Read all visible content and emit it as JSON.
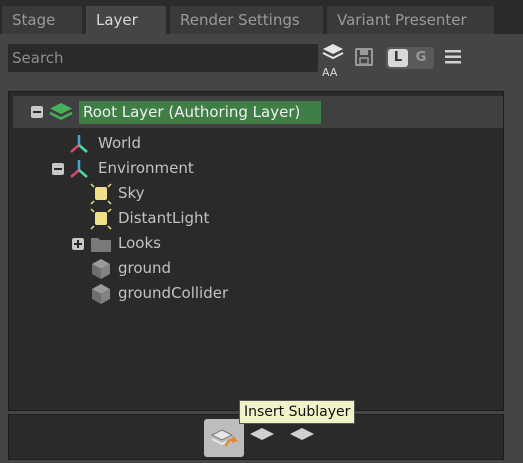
{
  "tabs": [
    {
      "label": "Stage",
      "active": false
    },
    {
      "label": "Layer",
      "active": true
    },
    {
      "label": "Render Settings",
      "active": false
    },
    {
      "label": "Variant Presenter",
      "active": false
    }
  ],
  "toolbar": {
    "search_placeholder": "Search",
    "stack_caption": "AA",
    "toggle_l": "L",
    "toggle_g": "G"
  },
  "tree": {
    "root": {
      "label": "Root Layer (Authoring Layer)",
      "expanded": true,
      "icon": "layers-stack-icon"
    },
    "items": [
      {
        "label": "World",
        "icon": "xform-axis-icon",
        "expander": "none"
      },
      {
        "label": "Environment",
        "icon": "xform-axis-icon",
        "expander": "expanded"
      },
      {
        "label": "Sky",
        "icon": "light-bulb-icon",
        "expander": "none"
      },
      {
        "label": "DistantLight",
        "icon": "light-bulb-icon",
        "expander": "none"
      },
      {
        "label": "Looks",
        "icon": "folder-icon",
        "expander": "collapsed"
      },
      {
        "label": "ground",
        "icon": "mesh-cube-icon",
        "expander": "none"
      },
      {
        "label": "groundCollider",
        "icon": "mesh-cube-icon",
        "expander": "none"
      }
    ]
  },
  "bottom": {
    "tooltip": "Insert Sublayer"
  },
  "colors": {
    "panel_bg": "#454545",
    "tree_bg": "#2a2a2a",
    "root_highlight": "#3f7e45",
    "light_yellow": "#f0e08a",
    "tooltip_bg": "#f2f2c8"
  }
}
